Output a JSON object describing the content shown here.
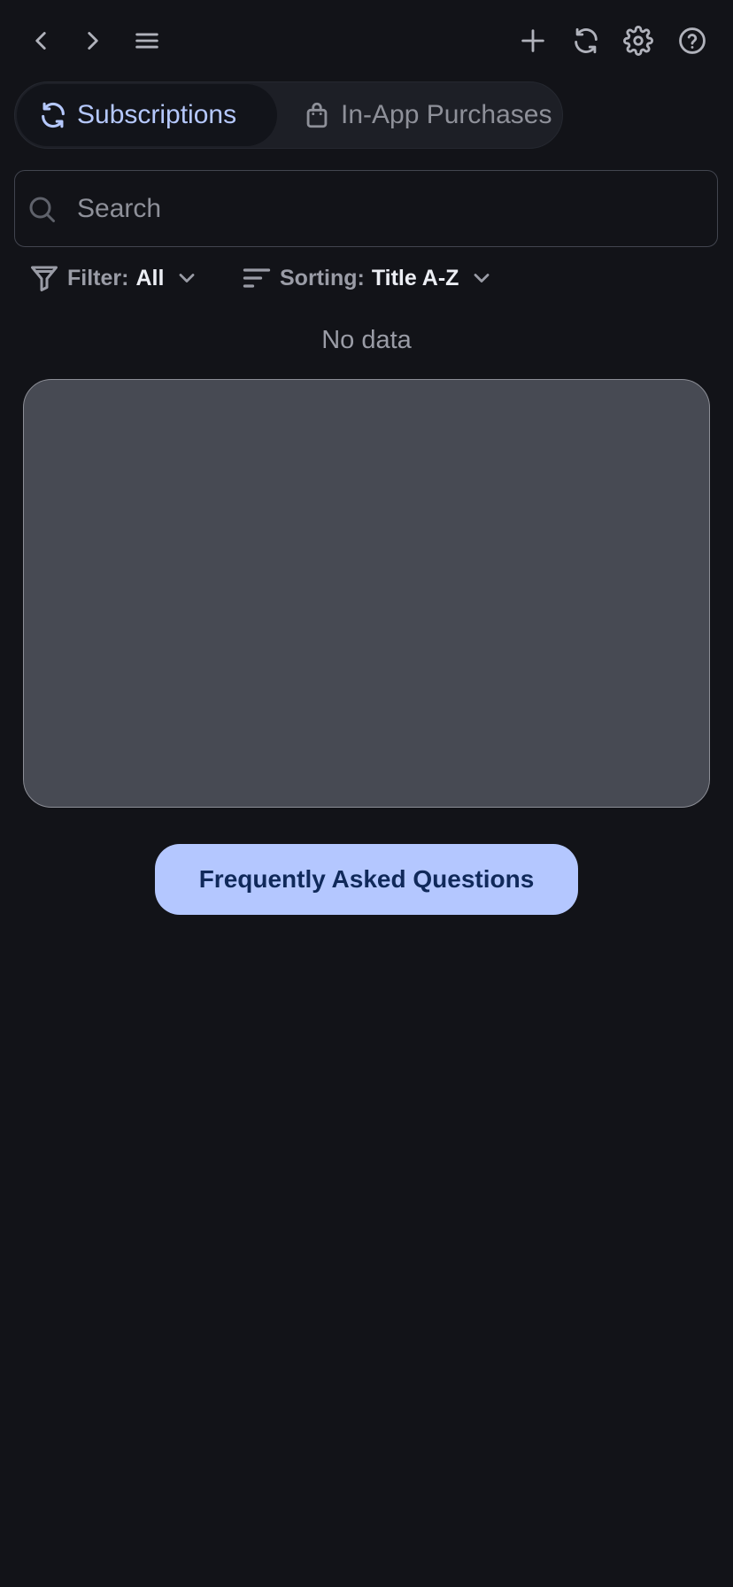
{
  "toolbar": {
    "icons": [
      "back-icon",
      "forward-icon",
      "menu-icon",
      "add-icon",
      "refresh-icon",
      "settings-icon",
      "help-icon"
    ]
  },
  "tabs": [
    {
      "label": "Subscriptions",
      "icon": "refresh-icon",
      "active": true
    },
    {
      "label": "In-App Purchases",
      "icon": "shopping-bag-icon",
      "active": false
    }
  ],
  "search": {
    "placeholder": "Search",
    "value": ""
  },
  "filter": {
    "key": "Filter:",
    "value": "All"
  },
  "sorting": {
    "key": "Sorting:",
    "value": "Title A-Z"
  },
  "empty_state": {
    "message": "No data"
  },
  "faq": {
    "label": "Frequently Asked Questions"
  },
  "colors": {
    "background": "#121318",
    "accent": "#b5c8fd",
    "faq_button": "#b4c7ff",
    "faq_text": "#10295a",
    "placeholder_card": "#474a53"
  }
}
